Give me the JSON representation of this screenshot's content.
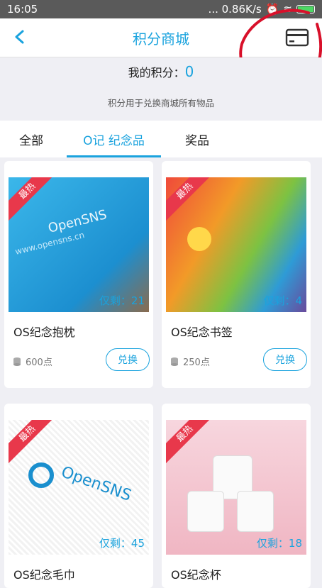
{
  "status_bar": {
    "time": "16:05",
    "network": "... 0.86K/s"
  },
  "header": {
    "title": "积分商城"
  },
  "points": {
    "label": "我的积分：",
    "value": "0",
    "description": "积分用于兑换商城所有物品"
  },
  "tabs": [
    {
      "label": "全部"
    },
    {
      "label": "O记 纪念品"
    },
    {
      "label": "奖品"
    }
  ],
  "active_tab": 1,
  "products": [
    {
      "ribbon": "最热",
      "stock": "仅剩：21",
      "name": "OS纪念抱枕",
      "price": "600点",
      "button": "兑换",
      "color": "#2aa8e0"
    },
    {
      "ribbon": "最热",
      "stock": "仅剩：4",
      "name": "OS纪念书签",
      "price": "250点",
      "button": "兑换",
      "color": "#f29a28"
    },
    {
      "ribbon": "最热",
      "stock": "仅剩：45",
      "name": "OS纪念毛巾",
      "price": "",
      "button": "",
      "color": "#ffffff"
    },
    {
      "ribbon": "最热",
      "stock": "仅剩：18",
      "name": "OS纪念杯",
      "price": "",
      "button": "",
      "color": "#f6c9d2"
    }
  ],
  "colors": {
    "accent": "#1aa3de",
    "ribbon": "#e8384b",
    "scribble": "#d8102a"
  }
}
